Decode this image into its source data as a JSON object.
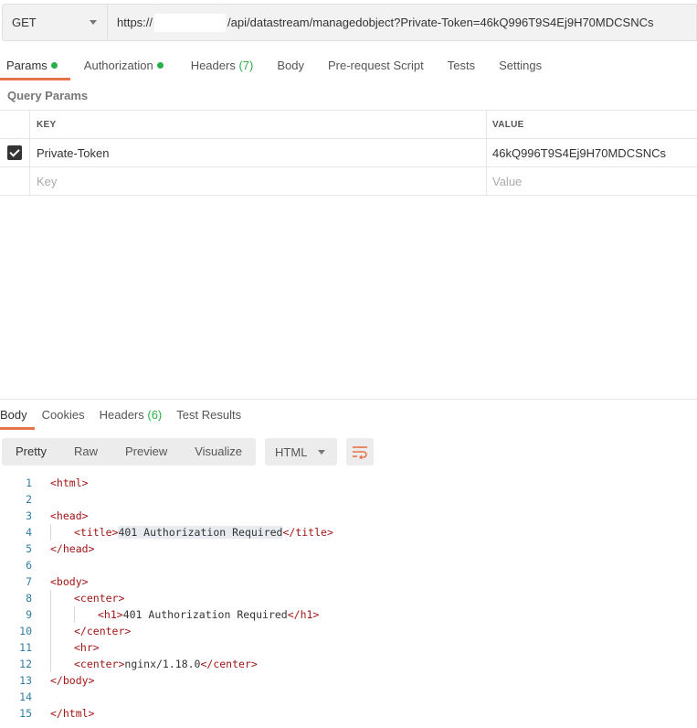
{
  "request": {
    "method": "GET",
    "url_prefix": "https://",
    "url_suffix": "/api/datastream/managedobject?Private-Token=46kQ996T9S4Ej9H70MDCSNCs"
  },
  "request_tabs": [
    {
      "label": "Params",
      "dot": true,
      "active": true
    },
    {
      "label": "Authorization",
      "dot": true
    },
    {
      "label": "Headers",
      "count": "(7)"
    },
    {
      "label": "Body"
    },
    {
      "label": "Pre-request Script"
    },
    {
      "label": "Tests"
    },
    {
      "label": "Settings"
    }
  ],
  "query_params": {
    "title": "Query Params",
    "key_header": "KEY",
    "value_header": "VALUE",
    "rows": [
      {
        "checked": true,
        "key": "Private-Token",
        "value": "46kQ996T9S4Ej9H70MDCSNCs"
      }
    ],
    "placeholder_key": "Key",
    "placeholder_value": "Value"
  },
  "response_tabs": [
    {
      "label": "Body",
      "active": true
    },
    {
      "label": "Cookies"
    },
    {
      "label": "Headers",
      "count": "(6)"
    },
    {
      "label": "Test Results"
    }
  ],
  "view_modes": [
    "Pretty",
    "Raw",
    "Preview",
    "Visualize"
  ],
  "active_view": "Pretty",
  "format": "HTML",
  "icons": {
    "wrap": "wrap-lines-icon",
    "dropdown": "chevron-down-icon"
  },
  "colors": {
    "accent": "#e8734a",
    "green": "#26b047",
    "tag": "#a31515",
    "line_number": "#2f7fa5"
  },
  "code_lines": [
    {
      "n": "1",
      "parts": [
        {
          "t": "<html>",
          "c": "tag"
        }
      ]
    },
    {
      "n": "2",
      "parts": []
    },
    {
      "n": "3",
      "parts": [
        {
          "t": "<head>",
          "c": "tag"
        }
      ]
    },
    {
      "n": "4",
      "indent": 1,
      "parts": [
        {
          "t": "<title>",
          "c": "tag"
        },
        {
          "t": "401 Authorization Required",
          "c": "hl"
        },
        {
          "t": "</title>",
          "c": "tag"
        }
      ]
    },
    {
      "n": "5",
      "parts": [
        {
          "t": "</head>",
          "c": "tag"
        }
      ]
    },
    {
      "n": "6",
      "parts": []
    },
    {
      "n": "7",
      "parts": [
        {
          "t": "<body>",
          "c": "tag"
        }
      ]
    },
    {
      "n": "8",
      "indent": 1,
      "parts": [
        {
          "t": "<center>",
          "c": "tag"
        }
      ]
    },
    {
      "n": "9",
      "indent": 2,
      "parts": [
        {
          "t": "<h1>",
          "c": "tag"
        },
        {
          "t": "401 Authorization Required",
          "c": "text"
        },
        {
          "t": "</h1>",
          "c": "tag"
        }
      ]
    },
    {
      "n": "10",
      "indent": 1,
      "parts": [
        {
          "t": "</center>",
          "c": "tag"
        }
      ]
    },
    {
      "n": "11",
      "indent": 1,
      "parts": [
        {
          "t": "<hr>",
          "c": "tag"
        }
      ]
    },
    {
      "n": "12",
      "indent": 1,
      "parts": [
        {
          "t": "<center>",
          "c": "tag"
        },
        {
          "t": "nginx/1.18.0",
          "c": "text"
        },
        {
          "t": "</center>",
          "c": "tag"
        }
      ]
    },
    {
      "n": "13",
      "parts": [
        {
          "t": "</body>",
          "c": "tag"
        }
      ]
    },
    {
      "n": "14",
      "parts": []
    },
    {
      "n": "15",
      "parts": [
        {
          "t": "</html>",
          "c": "tag"
        }
      ]
    }
  ]
}
